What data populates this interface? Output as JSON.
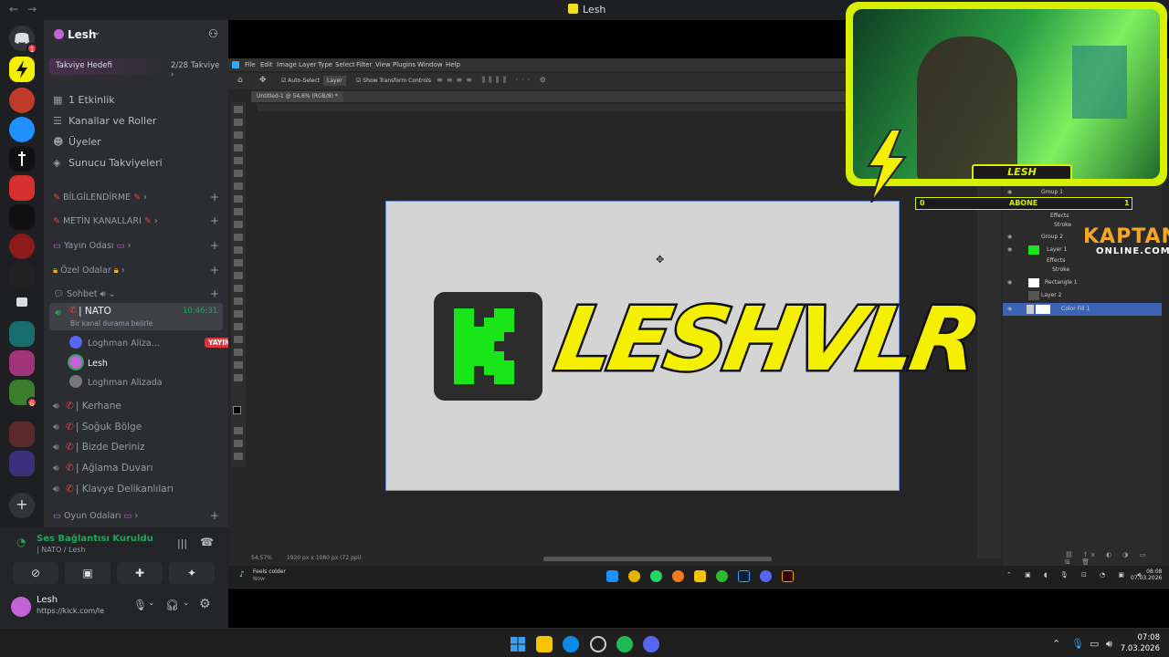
{
  "window": {
    "title": "Lesh",
    "back": "←",
    "forward": "→"
  },
  "server": {
    "name": "Lesh",
    "boost_label": "Takviye Hedefi",
    "boost_count": "2/28 Takviye ›"
  },
  "menu": [
    {
      "icon": "calendar-icon",
      "label": "1 Etkinlik"
    },
    {
      "icon": "channels-icon",
      "label": "Kanallar ve Roller"
    },
    {
      "icon": "members-icon",
      "label": "Üyeler"
    },
    {
      "icon": "boost-icon",
      "label": "Sunucu Takviyeleri"
    }
  ],
  "categories": {
    "bilgi": "BİLGİLENDİRME",
    "metin": "METİN KANALLARI",
    "yayin": "Yayın Odası",
    "ozel": "Özel Odalar",
    "sohbet": "Sohbet",
    "oyun": "Oyun Odaları"
  },
  "voice_channels": {
    "nato": {
      "name": "| NATO",
      "time": "10:46:31",
      "desc": "Bir kanal durama belirle"
    },
    "members": [
      {
        "name": "Loghman Aliza...",
        "live": "YAYINDA"
      },
      {
        "name": "Lesh"
      },
      {
        "name": "Loghman Alizada"
      }
    ],
    "others": [
      "| Kerhane",
      "| Soğuk Bölge",
      "| Bizde Deriniz",
      "| Ağlama Duvarı",
      "| Klavye Delikanlıları"
    ]
  },
  "voice_panel": {
    "status": "Ses Bağlantısı Kuruldu",
    "location": "| NATO / Lesh"
  },
  "user": {
    "name": "Lesh",
    "status": "https://kick.com/le"
  },
  "photoshop": {
    "menu": [
      "File",
      "Edit",
      "Image",
      "Layer",
      "Type",
      "Select",
      "Filter",
      "View",
      "Plugins",
      "Window",
      "Help"
    ],
    "options": {
      "auto_select": "Auto-Select",
      "target": "Layer",
      "transform": "Show Transform Controls"
    },
    "doc_tab": "Untitled-1 @ 54,6% (RGB/8) *",
    "wordmark": "LESHVLR",
    "zoom": "54,57%",
    "doc_size": "1920 px x 1080 px (72 ppi)",
    "layers": [
      {
        "name": "Group 1"
      },
      {
        "name": "Effects"
      },
      {
        "name": "Stroke"
      },
      {
        "name": "Group 2"
      },
      {
        "name": "Layer 1"
      },
      {
        "name": "Effects"
      },
      {
        "name": "Stroke"
      },
      {
        "name": "Rectangle 1"
      },
      {
        "name": "Layer 2"
      },
      {
        "name": "Color Fill 1"
      }
    ]
  },
  "overlay": {
    "cam_label": "LESH",
    "abone_left": "0",
    "abone_label": "ABONE",
    "abone_right": "1",
    "kaptan_top": "KAPTAN",
    "kaptan_bottom": "ONLINE.COM"
  },
  "stream_taskbar": {
    "song": "Feels colder",
    "sub": "Now",
    "time": "08:08",
    "date": "07.03.2026"
  },
  "taskbar": {
    "time": "07:08",
    "date": "7.03.2026"
  },
  "colors": {
    "accent_yellow": "#f5f000",
    "kick_green": "#19e619",
    "discord_green": "#23a55a",
    "live_red": "#da373c"
  }
}
